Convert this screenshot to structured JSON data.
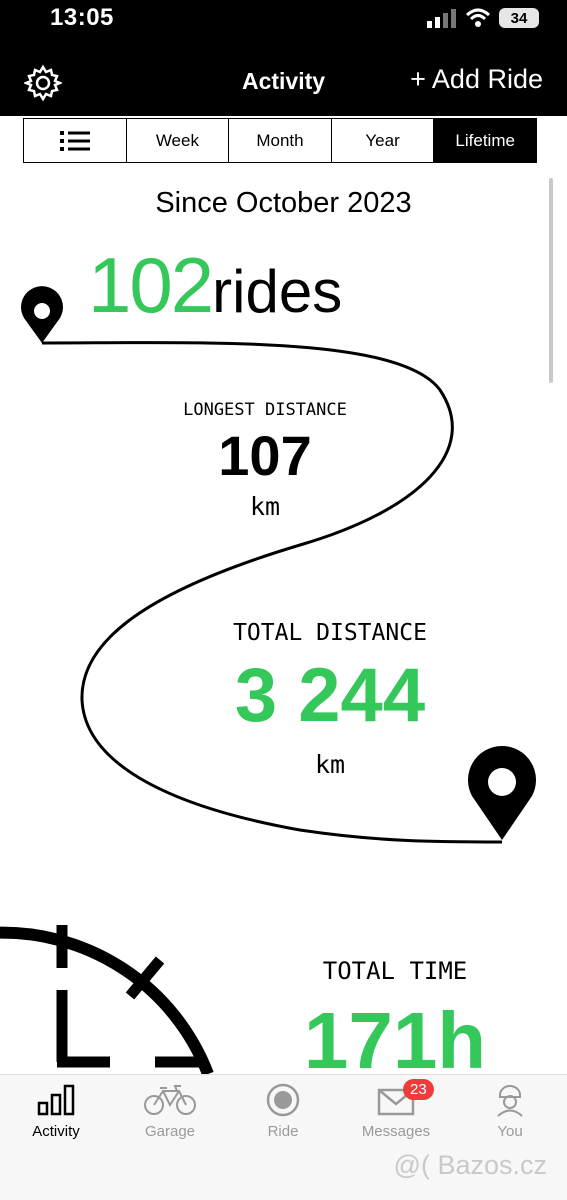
{
  "status": {
    "time": "13:05",
    "battery": "34"
  },
  "header": {
    "title": "Activity",
    "add_ride": "+ Add Ride"
  },
  "segments": [
    {
      "label": ""
    },
    {
      "label": "Week"
    },
    {
      "label": "Month"
    },
    {
      "label": "Year"
    },
    {
      "label": "Lifetime"
    }
  ],
  "active_segment": "Lifetime",
  "summary": {
    "since": "Since October 2023",
    "rides_count": "102",
    "rides_word": "rides"
  },
  "stats": {
    "longest_label": "LONGEST DISTANCE",
    "longest_value": "107",
    "longest_unit": "km",
    "total_distance_label": "TOTAL DISTANCE",
    "total_distance_value": "3 244",
    "total_distance_unit": "km",
    "total_time_label": "TOTAL TIME",
    "total_time_value": "171h"
  },
  "tabbar": {
    "items": [
      {
        "label": "Activity",
        "icon": "bar-chart-icon"
      },
      {
        "label": "Garage",
        "icon": "bicycle-icon"
      },
      {
        "label": "Ride",
        "icon": "record-icon"
      },
      {
        "label": "Messages",
        "icon": "envelope-icon"
      },
      {
        "label": "You",
        "icon": "helmet-person-icon"
      }
    ],
    "messages_badge": "23"
  },
  "watermark": "@( Bazos.cz",
  "colors": {
    "accent_green": "#34c759",
    "badge_red": "#ef3b3b"
  }
}
